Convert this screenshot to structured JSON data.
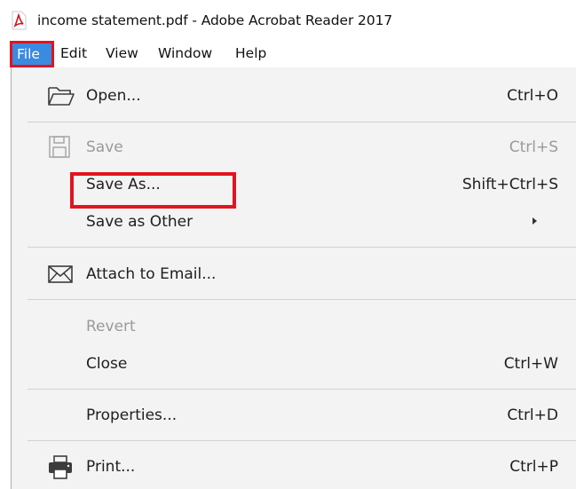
{
  "window": {
    "title": "income statement.pdf - Adobe Acrobat Reader 2017",
    "app_icon": "acrobat-pdf-icon"
  },
  "menubar": {
    "items": [
      {
        "label": "File"
      },
      {
        "label": "Edit"
      },
      {
        "label": "View"
      },
      {
        "label": "Window"
      },
      {
        "label": "Help"
      }
    ]
  },
  "file_menu": {
    "open": {
      "label": "Open...",
      "shortcut": "Ctrl+O",
      "icon": "folder-open-icon"
    },
    "save": {
      "label": "Save",
      "shortcut": "Ctrl+S",
      "icon": "floppy-disk-icon",
      "disabled": true
    },
    "save_as": {
      "label": "Save As...",
      "shortcut": "Shift+Ctrl+S",
      "highlighted": true
    },
    "save_as_other": {
      "label": "Save as Other",
      "has_submenu": true
    },
    "attach_email": {
      "label": "Attach to Email...",
      "icon": "envelope-icon"
    },
    "revert": {
      "label": "Revert",
      "disabled": true
    },
    "close": {
      "label": "Close",
      "shortcut": "Ctrl+W"
    },
    "properties": {
      "label": "Properties...",
      "shortcut": "Ctrl+D"
    },
    "print": {
      "label": "Print...",
      "shortcut": "Ctrl+P",
      "icon": "printer-icon"
    }
  },
  "colors": {
    "highlight_red": "#e1141f",
    "file_menu_active": "#3a8ae0",
    "menu_background": "#f3f3f3",
    "disabled_text": "#9a9a9a"
  }
}
